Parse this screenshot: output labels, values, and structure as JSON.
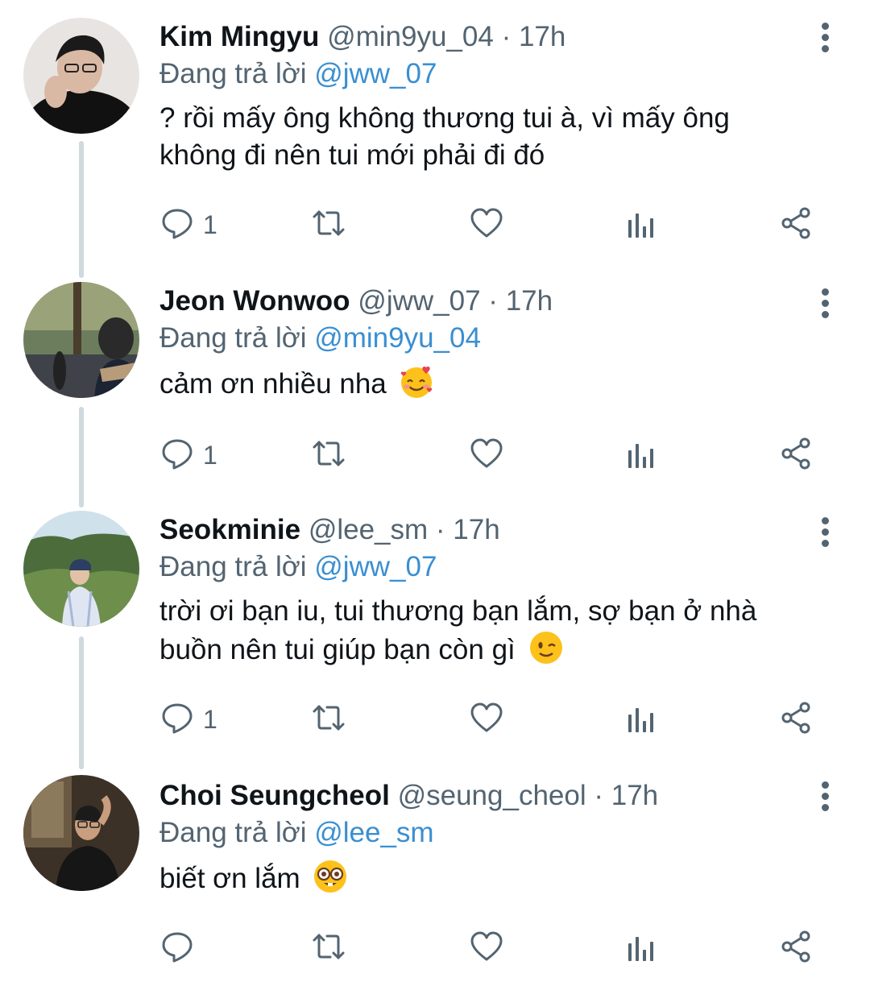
{
  "tweets": [
    {
      "name": "Kim Mingyu",
      "handle": "@min9yu_04",
      "separator": "·",
      "time": "17h",
      "reply_prefix": "Đang trả lời",
      "reply_to": "@jww_07",
      "text_lines": [
        "? rồi mấy ông không thương tui à, vì mấy ông",
        "không đi nên tui mới phải đi đó"
      ],
      "emoji": "",
      "reply_count": "1"
    },
    {
      "name": "Jeon Wonwoo",
      "handle": "@jww_07",
      "separator": "·",
      "time": "17h",
      "reply_prefix": "Đang trả lời",
      "reply_to": "@min9yu_04",
      "text_lines": [
        "cảm ơn nhiều nha"
      ],
      "emoji": "smiling-face-with-hearts",
      "reply_count": "1"
    },
    {
      "name": "Seokminie",
      "handle": "@lee_sm",
      "separator": "·",
      "time": "17h",
      "reply_prefix": "Đang trả lời",
      "reply_to": "@jww_07",
      "text_lines": [
        "trời ơi bạn iu, tui thương bạn lắm, sợ bạn ở nhà",
        "buồn nên tui giúp bạn còn gì"
      ],
      "emoji": "winking-face",
      "reply_count": "1"
    },
    {
      "name": "Choi Seungcheol",
      "handle": "@seung_cheol",
      "separator": "·",
      "time": "17h",
      "reply_prefix": "Đang trả lời",
      "reply_to": "@lee_sm",
      "text_lines": [
        "biết ơn lắm"
      ],
      "emoji": "nerd-face",
      "reply_count": ""
    }
  ],
  "icons": {
    "reply": "reply-icon",
    "retweet": "retweet-icon",
    "like": "heart-icon",
    "views": "analytics-icon",
    "share": "share-icon",
    "more": "more-options-icon"
  },
  "colors": {
    "text": "#0f1419",
    "secondary": "#536471",
    "mention": "#3a8fd1",
    "thread_line": "#cfd9de"
  }
}
